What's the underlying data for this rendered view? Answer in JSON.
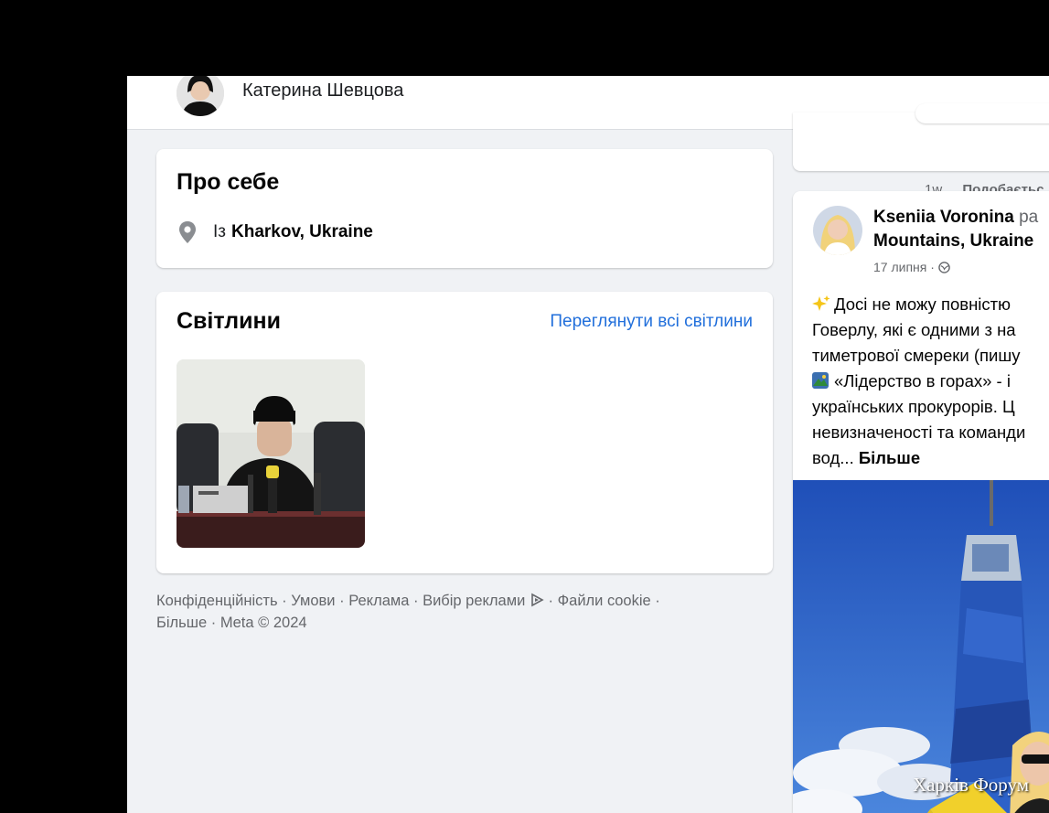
{
  "profile": {
    "name": "Катерина Шевцова"
  },
  "about": {
    "title": "Про себе",
    "location_prefix": "Із",
    "location": "Kharkov, Ukraine",
    "icon": "location-pin-icon"
  },
  "photos": {
    "title": "Світлини",
    "see_all": "Переглянути всі світлини"
  },
  "footer": {
    "links": [
      "Конфіденційність",
      "Умови",
      "Реклама",
      "Вибір реклами",
      "Файли cookie",
      "Більше"
    ],
    "separator": "·",
    "copyright": "Meta © 2024"
  },
  "prev_post": {
    "time": "1w",
    "like_label": "Подобаєтьс"
  },
  "post": {
    "author": "Kseniia Voronina",
    "author_rest": "ра",
    "place": "Mountains, Ukraine",
    "date": "17 липня ·",
    "lines": [
      "Досі не можу повністю",
      "Говерлу, які є одними з на",
      "тиметрової смереки (пишу",
      "«Лідерство в горах» - і",
      "українських прокурорів. Ц",
      "невизначеності та команди"
    ],
    "last_line": "вод...",
    "more_label": "Більше"
  },
  "watermark": "Харків Форум",
  "colors": {
    "link": "#216fdb",
    "secondary": "#65676b",
    "page_bg": "#f0f2f5"
  }
}
